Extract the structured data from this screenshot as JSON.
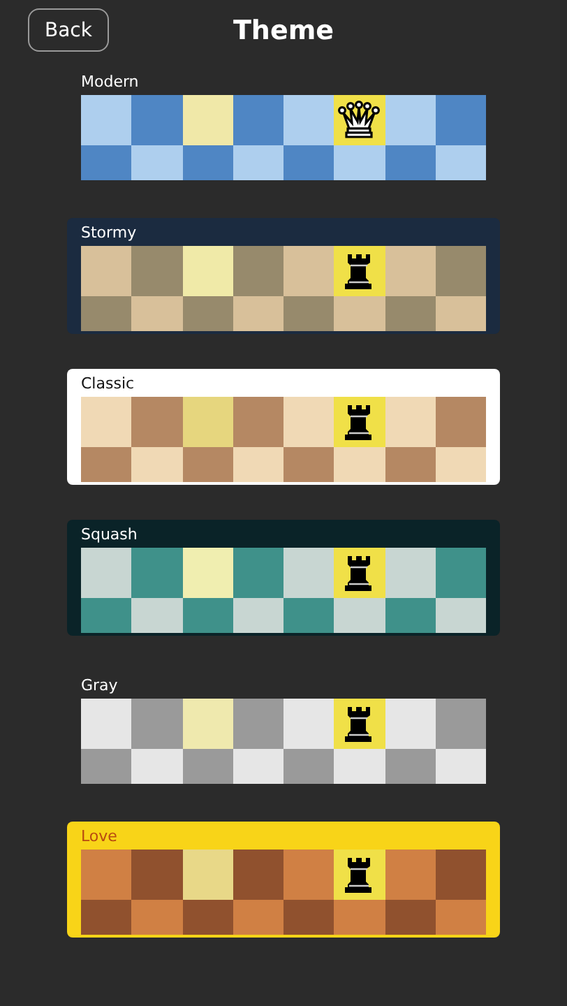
{
  "header": {
    "back_button": "Back",
    "title": "Theme"
  },
  "themes": [
    {
      "name": "Modern",
      "kind": "queen",
      "palette": [
        {
          "color": "#aecfee"
        },
        {
          "color": "#4f86c4"
        },
        {
          "color": "#f0e8a8"
        },
        {
          "color": "#ffffff"
        }
      ]
    },
    {
      "name": "Stormy",
      "kind": "rook",
      "color": "#1b2b40",
      "palette": [
        {
          "color": "#d8c09a"
        },
        {
          "color": "#978a6c"
        },
        {
          "color": "#f0eaa8"
        },
        {
          "color": "#ffffff"
        }
      ]
    },
    {
      "name": "Classic",
      "kind": "rook",
      "color": "#ffffff",
      "palette": [
        {
          "color": "#f0d9b5"
        },
        {
          "color": "#b58863"
        },
        {
          "color": "#e6d67e"
        },
        {
          "color": "#111111"
        }
      ]
    },
    {
      "name": "Squash",
      "kind": "rook",
      "color": "#0a2328",
      "palette": [
        {
          "color": "#c8d6d2"
        },
        {
          "color": "#3f918a"
        },
        {
          "color": "#f0eeb0"
        },
        {
          "color": "#ffffff"
        }
      ]
    },
    {
      "name": "Gray",
      "kind": "rook",
      "palette": [
        {
          "color": "#e6e6e6"
        },
        {
          "color": "#9a9a9a"
        },
        {
          "color": "#efe9ae"
        },
        {
          "color": "#ffffff"
        }
      ]
    },
    {
      "name": "Love",
      "kind": "rook",
      "color": "#f8d418",
      "palette": [
        {
          "color": "#d08044"
        },
        {
          "color": "#90512e"
        },
        {
          "color": "#e8d888"
        },
        {
          "color": "#b84a10"
        }
      ]
    }
  ]
}
